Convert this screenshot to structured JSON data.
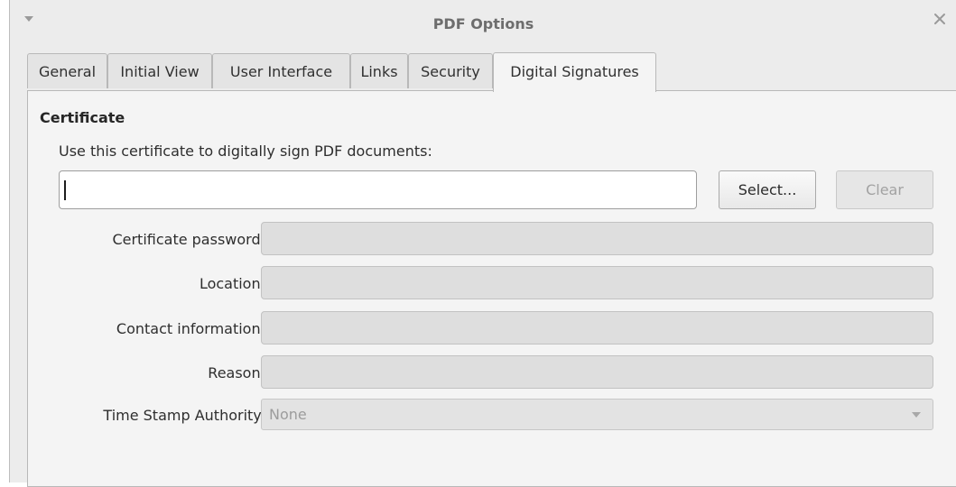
{
  "window": {
    "title": "PDF Options"
  },
  "tabs": [
    {
      "label": "General",
      "active": false
    },
    {
      "label": "Initial View",
      "active": false
    },
    {
      "label": "User Interface",
      "active": false
    },
    {
      "label": "Links",
      "active": false
    },
    {
      "label": "Security",
      "active": false
    },
    {
      "label": "Digital Signatures",
      "active": true
    }
  ],
  "certificate": {
    "section_title": "Certificate",
    "instruction": "Use this certificate to digitally sign PDF documents:",
    "value": "",
    "select_label": "Select...",
    "clear_label": "Clear"
  },
  "fields": {
    "password_label": "Certificate password:",
    "location_label": "Location:",
    "contact_label": "Contact information:",
    "reason_label": "Reason:",
    "tsa_label": "Time Stamp Authority:",
    "tsa_value": "None"
  },
  "icons": {
    "window_menu": "chevron-down-icon",
    "close": "close-icon",
    "dropdown": "chevron-down-icon"
  },
  "colors": {
    "window_bg": "#ececec",
    "panel_bg": "#f4f4f4",
    "disabled_field": "#dedede",
    "title_text": "#6d6d6d"
  }
}
